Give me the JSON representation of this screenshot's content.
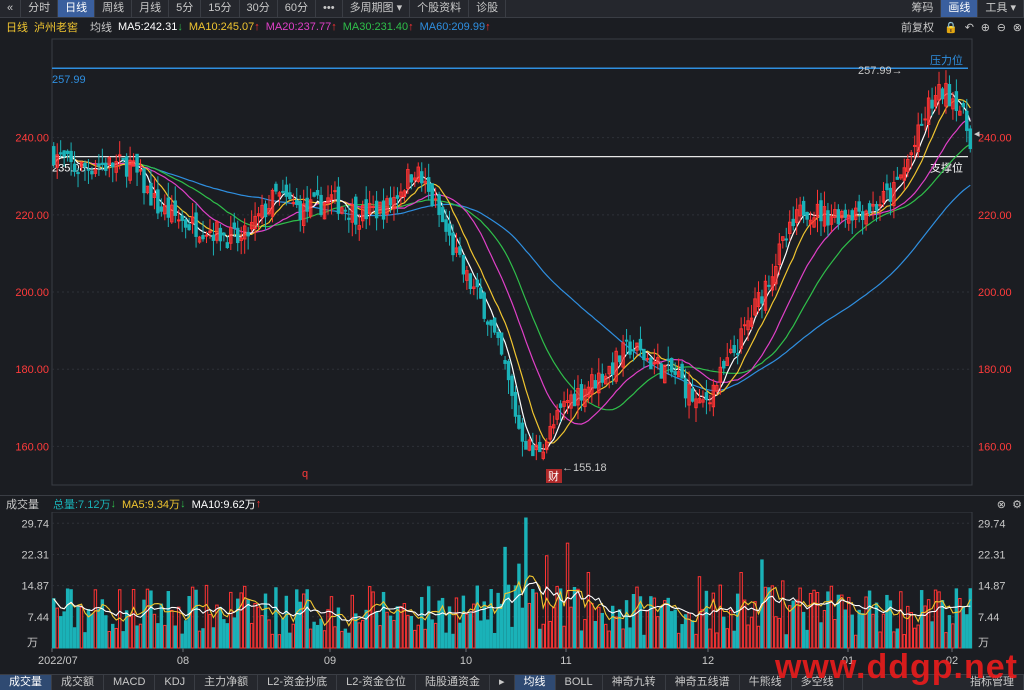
{
  "toolbar": {
    "back_icon": "«",
    "tabs": [
      "分时",
      "日线",
      "周线",
      "月线",
      "5分",
      "15分",
      "30分",
      "60分",
      "•••",
      "多周期图 ▾",
      "个股资料",
      "诊股"
    ],
    "active_index": 1,
    "right": [
      "筹码",
      "画线",
      "工具 ▾"
    ],
    "right_active_index": 1
  },
  "info": {
    "period": "日线",
    "stock_name": "泸州老窖",
    "ma_label": "均线",
    "ma5": "MA5:242.31",
    "ma10": "MA10:245.07",
    "ma20": "MA20:237.77",
    "ma30": "MA30:231.40",
    "ma60": "MA60:209.99",
    "adjust": "前复权"
  },
  "colors": {
    "up": "#ff3333",
    "down": "#1ab2b8",
    "ma5": "#ffffff",
    "ma10": "#f0c530",
    "ma20": "#e040c8",
    "ma30": "#2fbf4a",
    "ma60": "#2f8fe0"
  },
  "annotations": {
    "resistance": "压力位",
    "resistance_value": "257.99",
    "high_label": "257.99→",
    "support_value": "235.08",
    "support": "支撑位",
    "low_label": "←155.18",
    "q_marker": "q",
    "cai_marker": "财"
  },
  "volume": {
    "title": "成交量",
    "total": "总量:7.12万",
    "ma5": "MA5:9.34万",
    "ma10": "MA10:9.62万",
    "unit": "万"
  },
  "bottom_tabs": [
    "成交量",
    "成交额",
    "MACD",
    "KDJ",
    "主力净额",
    "L2-资金抄底",
    "L2-资金仓位",
    "陆股通资金",
    "▸",
    "均线",
    "BOLL",
    "神奇九转",
    "神奇五线谱",
    "牛熊线",
    "多空线",
    "",
    "指标管理"
  ],
  "bottom_active": [
    0,
    9
  ],
  "watermark": "www.ddgp.net",
  "chart_data": {
    "type": "candlestick",
    "y_ticks": [
      "240.00",
      "220.00",
      "200.00",
      "180.00",
      "160.00"
    ],
    "y_range": [
      150,
      264
    ],
    "x_ticks": [
      "2022/07",
      "08",
      "09",
      "10",
      "11",
      "12",
      "01",
      "02"
    ],
    "price_levels": {
      "resistance": 257.99,
      "support": 235.08,
      "high": 257.99,
      "low": 155.18
    },
    "vol_ticks": [
      "29.74",
      "22.31",
      "14.87",
      "7.44",
      "万"
    ],
    "vol_range": [
      0,
      31
    ],
    "anchors": [
      [
        0,
        236
      ],
      [
        6,
        232
      ],
      [
        14,
        233
      ],
      [
        22,
        233
      ],
      [
        30,
        222
      ],
      [
        38,
        218
      ],
      [
        46,
        216
      ],
      [
        54,
        213
      ],
      [
        64,
        225
      ],
      [
        72,
        221
      ],
      [
        80,
        224
      ],
      [
        88,
        220
      ],
      [
        96,
        222
      ],
      [
        104,
        232
      ],
      [
        110,
        222
      ],
      [
        118,
        205
      ],
      [
        124,
        196
      ],
      [
        130,
        180
      ],
      [
        134,
        165
      ],
      [
        138,
        158
      ],
      [
        142,
        162
      ],
      [
        148,
        172
      ],
      [
        154,
        176
      ],
      [
        160,
        180
      ],
      [
        166,
        186
      ],
      [
        172,
        182
      ],
      [
        180,
        178
      ],
      [
        186,
        170
      ],
      [
        192,
        178
      ],
      [
        198,
        188
      ],
      [
        204,
        200
      ],
      [
        210,
        212
      ],
      [
        216,
        222
      ],
      [
        222,
        220
      ],
      [
        230,
        221
      ],
      [
        236,
        222
      ],
      [
        242,
        226
      ],
      [
        248,
        238
      ],
      [
        252,
        248
      ],
      [
        256,
        252
      ],
      [
        260,
        250
      ],
      [
        264,
        240
      ]
    ]
  }
}
